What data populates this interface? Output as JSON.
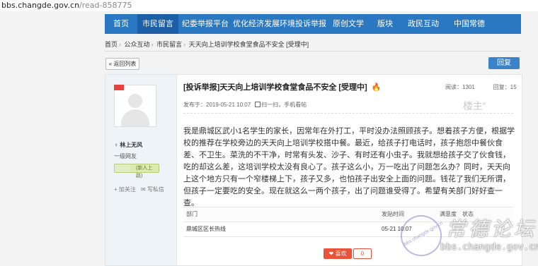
{
  "url": {
    "domain": "bbs.changde.gov.cn",
    "path": "/read-858775"
  },
  "nav": {
    "items": [
      "首页",
      "市民留言",
      "纪委举报平台",
      "优化经济发展环境投诉举报",
      "原创文学",
      "版块",
      "政民互动",
      "中国常德"
    ],
    "active": 1
  },
  "breadcrumb": [
    "首页",
    "公众互动",
    "市民留言",
    "天天向上培训学校食堂食品不安全 [受理中]"
  ],
  "back_label": "« 返回列表",
  "reply_label": "回复",
  "user": {
    "name": "林上无风",
    "group": "一级网友",
    "badge": "(新人上路)",
    "follow": "+ 加关注",
    "message": "写私信"
  },
  "post": {
    "title": "[投诉举报]天天向上培训学校食堂食品不安全 [受理中]",
    "views_label": "阅读：1301",
    "replies_label": "回复：15",
    "published": "发布于：2019-05-21 10:07",
    "scan": "扫一扫，手机看帖",
    "floor_label": "楼主",
    "body": "我是鼎城区武小1名学生的家长，因常年在外打工，平时没办法照顾孩子。想着孩子方便，根据学校的推荐在学校旁边的天天向上培训学校搭中餐。最近，给孩子打电话时，孩子抱怨中餐伙食差、不卫生。菜洗的不干净，时常有头发、沙子、有时还有小虫子。我就想给孩子交了伙食钱，吃的却这么差，这培训学校太没有良心了。孩子这么小，万一吃出了问题怎么办？同时，天天向上这个地方只有一个窄楼梯上下，孩子又多，也怕孩子出安全上面的问题。钱花了我们无所谓，但孩子一定要吃的安全。现在就这么一两个孩子，出了问题谁受得了。希望有关部门好好查一查。",
    "table": {
      "headers": [
        "部门",
        "发贴时间",
        "满意度",
        "状态"
      ],
      "rows": [
        [
          "鼎城区区长热线",
          "05-21 10:07",
          "",
          ""
        ]
      ]
    },
    "like_label": "❤ 喜欢",
    "like_count": "0"
  },
  "watermark": {
    "logo_text": "常德论坛",
    "url": "bbs.changde.gov.cn",
    "seal_text": "bbs.changde.gov.cn"
  }
}
